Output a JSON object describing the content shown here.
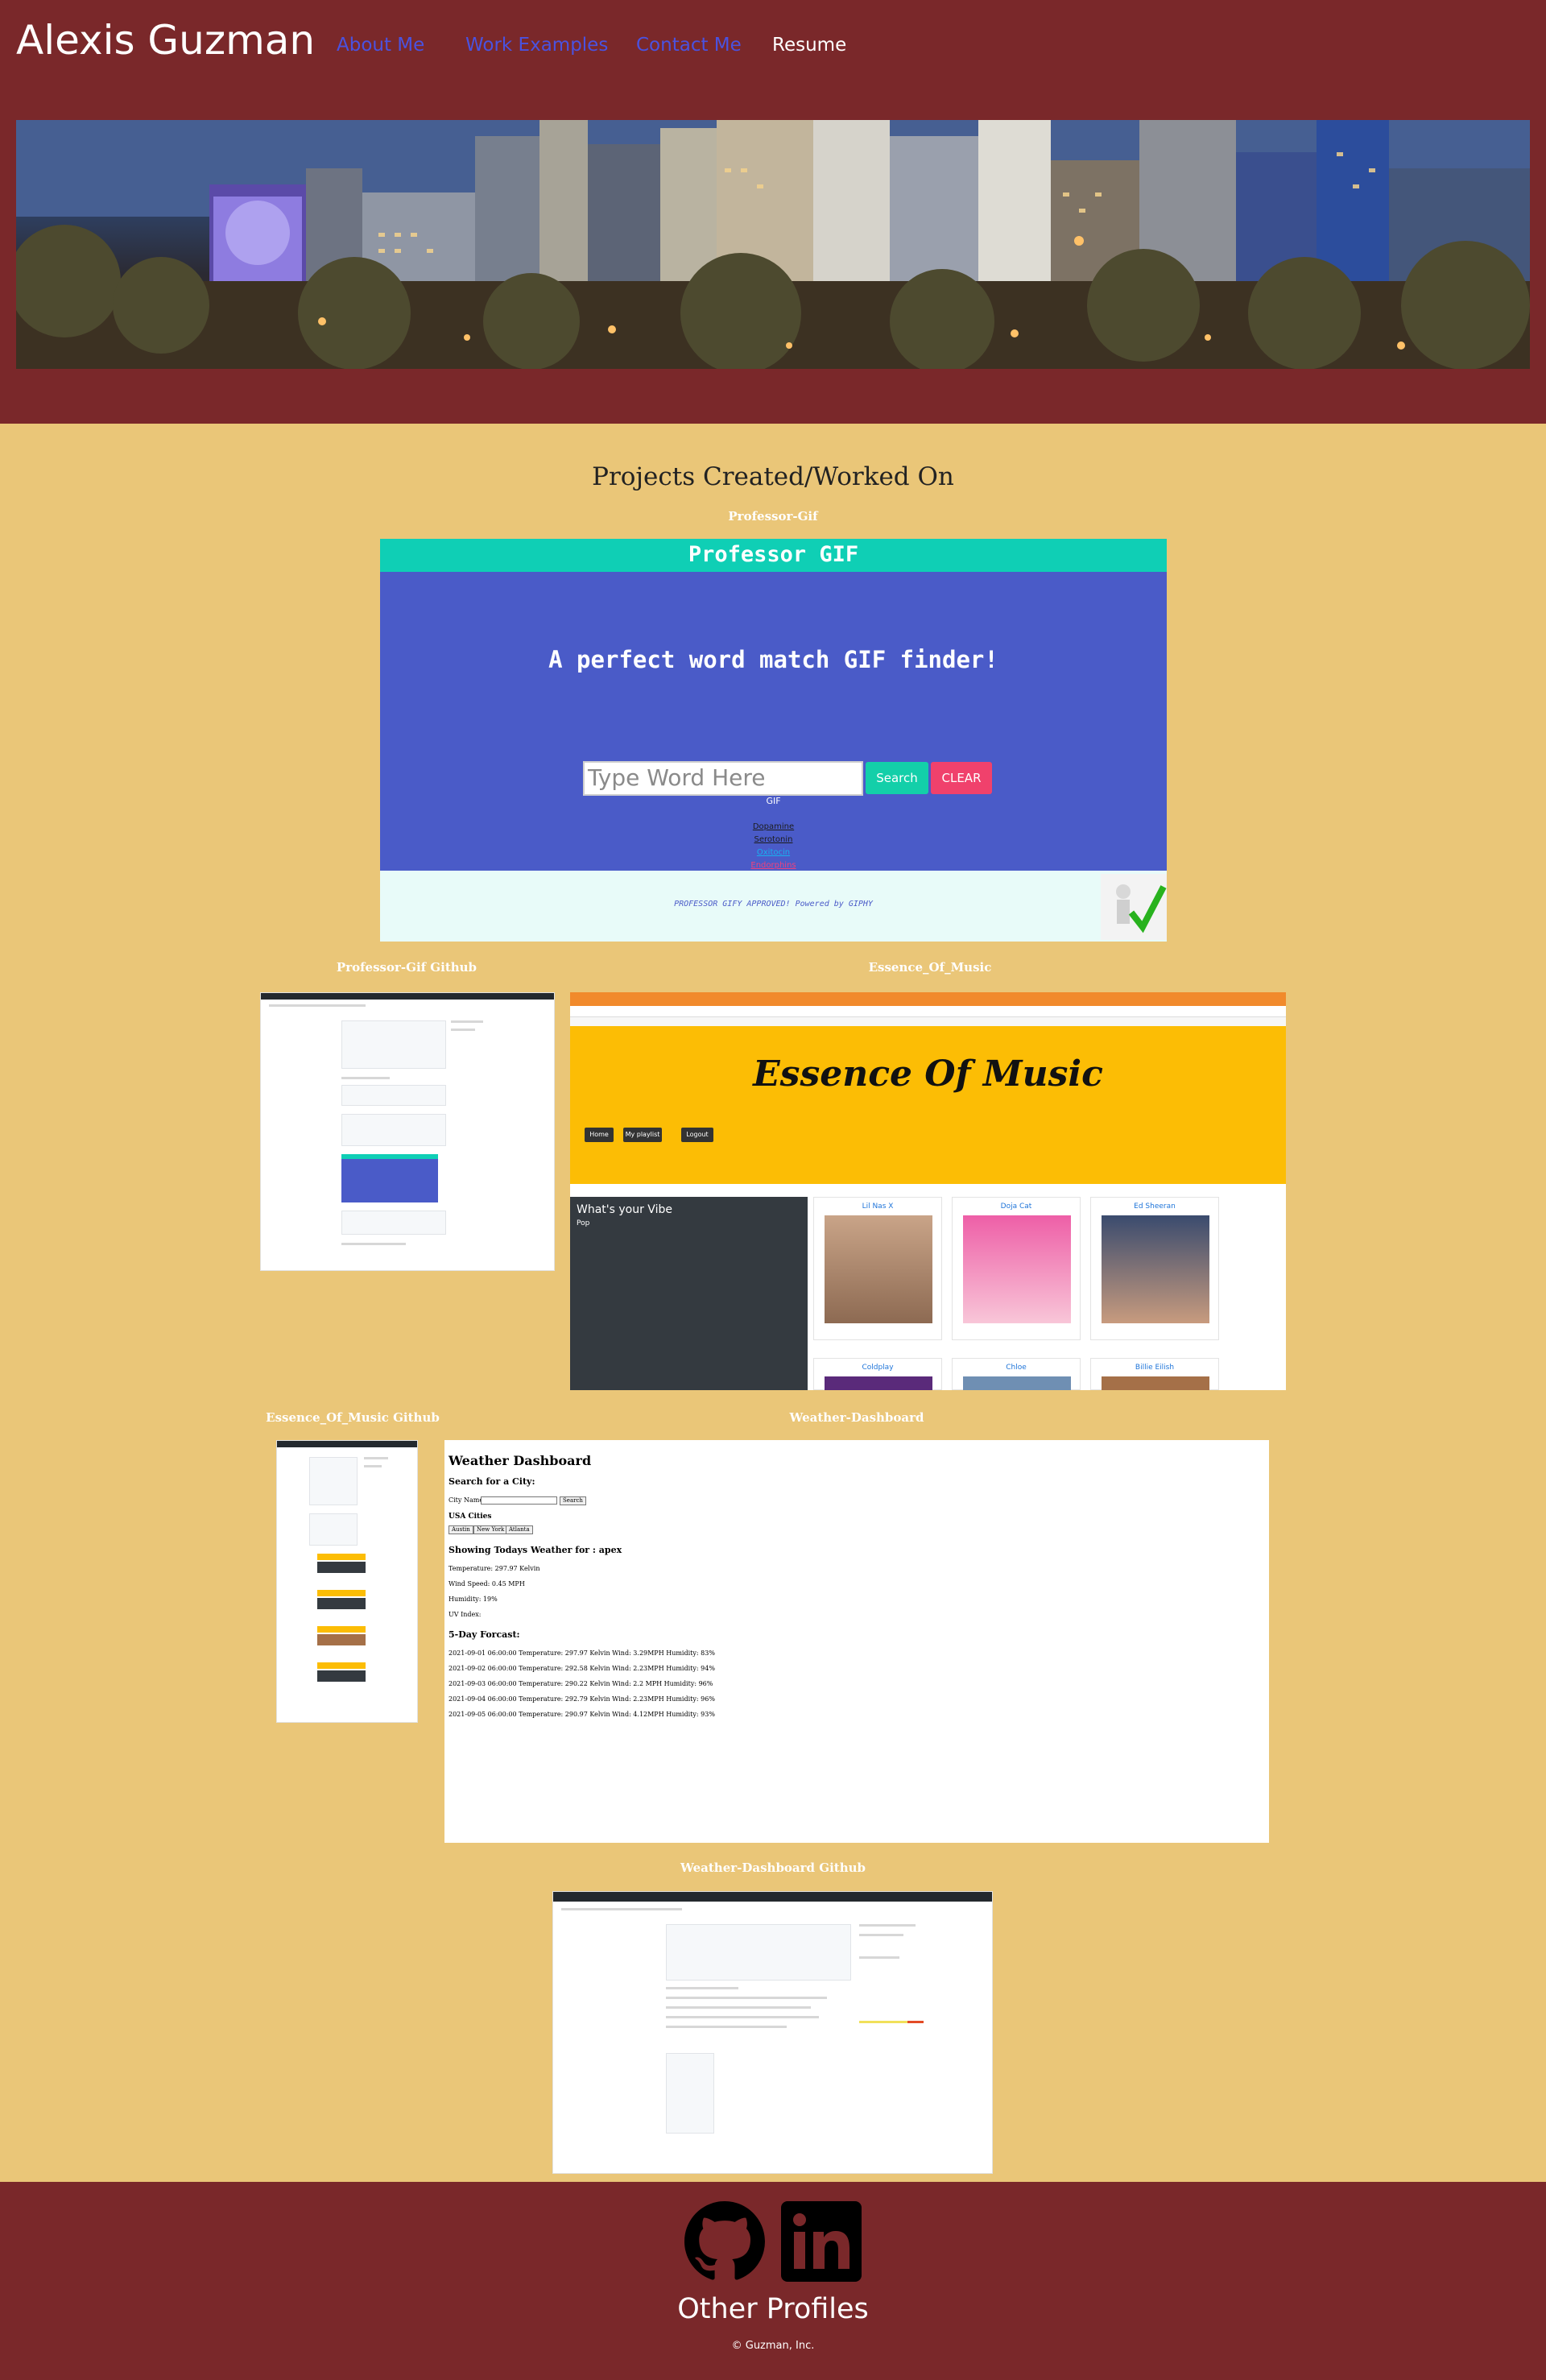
{
  "header": {
    "title": "Alexis Guzman",
    "nav": [
      "About Me",
      "Work Examples",
      "Contact Me",
      "Resume"
    ]
  },
  "main": {
    "section_title": "Projects Created/Worked On",
    "projects": [
      {
        "caption": "Professor-Gif",
        "screenshot": {
          "app_title": "Professor GIF",
          "tagline": "A perfect word match GIF finder!",
          "input_placeholder": "Type Word Here",
          "search_label": "Search",
          "clear_label": "CLEAR",
          "gif_label": "GIF",
          "links": [
            "Dopamine",
            "Serotonin",
            "Oxitocin",
            "Endorphins"
          ],
          "footer_text": "PROFESSOR GIFY APPROVED! Powered by GIPHY"
        }
      },
      {
        "caption": "Professor-Gif Github"
      },
      {
        "caption": "Essence_Of_Music",
        "screenshot": {
          "app_title": "Essence Of Music",
          "buttons": [
            "Home",
            "My playlist",
            "Logout"
          ],
          "sidebar_title": "What's your Vibe",
          "sidebar_genre": "Pop",
          "artists": [
            "Lil Nas X",
            "Doja Cat",
            "Ed Sheeran",
            "Coldplay",
            "Chloe",
            "Billie Eilish"
          ]
        }
      },
      {
        "caption": "Essence_Of_Music Github"
      },
      {
        "caption": "Weather-Dashboard",
        "screenshot": {
          "title": "Weather Dashboard",
          "search_heading": "Search for a City:",
          "city_label": "City Name:",
          "search_label": "Search",
          "usa_heading": "USA Cities",
          "cities": [
            "Austin",
            "New York",
            "Atlanta"
          ],
          "today_heading": "Showing Todays Weather for : apex",
          "temperature": "Temperature: 297.97 Kelvin",
          "wind": "Wind Speed: 0.45 MPH",
          "humidity": "Humidity: 19%",
          "uv": "UV Index:",
          "forecast_heading": "5-Day Forcast:",
          "forecast": [
            "2021-09-01 06:00:00 Temperature: 297.97 Kelvin Wind: 3.29MPH Humidity: 83%",
            "2021-09-02 06:00:00 Temperature: 292.58 Kelvin Wind: 2.23MPH Humidity: 94%",
            "2021-09-03 06:00:00 Temperature: 290.22 Kelvin Wind: 2.2 MPH Humidity: 96%",
            "2021-09-04 06:00:00 Temperature: 292.79 Kelvin Wind: 2.23MPH Humidity: 96%",
            "2021-09-05 06:00:00 Temperature: 290.97 Kelvin Wind: 4.12MPH Humidity: 93%"
          ]
        }
      },
      {
        "caption": "Weather-Dashboard Github"
      }
    ]
  },
  "footer": {
    "icons": [
      "github-icon",
      "linkedin-icon"
    ],
    "label": "Other Profiles",
    "copyright": "© Guzman, Inc."
  },
  "colors": {
    "header_bg": "#7a282a",
    "page_bg": "#eac678",
    "nav_link": "#4a52e0",
    "nav_active": "#ffffff"
  }
}
